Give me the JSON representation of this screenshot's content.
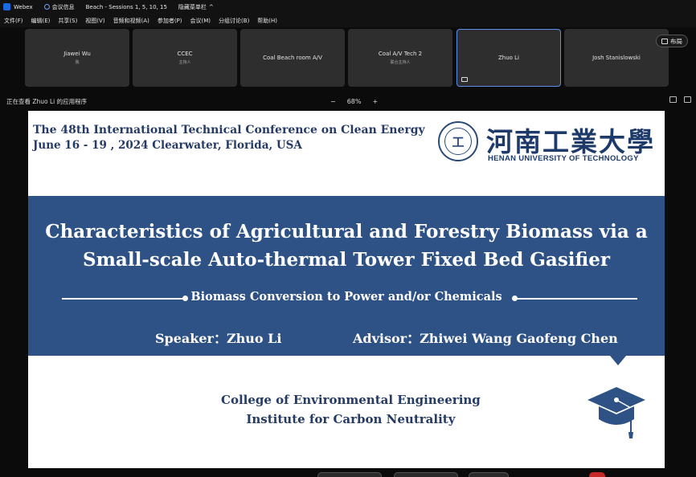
{
  "titlebar": {
    "app": "Webex",
    "meeting_info": "会议信息",
    "session": "Beach - Sessions 1, 5, 10, 15",
    "hide_menu": "隐藏菜单栏"
  },
  "menubar": [
    "文件(F)",
    "编辑(E)",
    "共享(S)",
    "视图(V)",
    "音频和视频(A)",
    "参加者(P)",
    "会议(M)",
    "分组讨论(B)",
    "帮助(H)"
  ],
  "participants": [
    {
      "name": "Jiawei Wu",
      "role": "我"
    },
    {
      "name": "CCEC",
      "role": "主持人"
    },
    {
      "name": "Coal Beach room A/V",
      "role": ""
    },
    {
      "name": "Coal A/V Tech 2",
      "role": "联合主持人"
    },
    {
      "name": "Zhuo Li",
      "role": ""
    },
    {
      "name": "Josh Stanislowski",
      "role": ""
    }
  ],
  "layout_button": "布局",
  "share_status": "正在查看 Zhuo Li 的应用程序",
  "zoom": {
    "minus": "−",
    "level": "68%",
    "plus": "+"
  },
  "slide": {
    "conference_line1": "The 48th International Technical Conference on Clean Energy",
    "conference_line2": "June 16 - 19 , 2024 Clearwater, Florida, USA",
    "university_cn": "河南工業大學",
    "university_en": "HENAN UNIVERSITY OF TECHNOLOGY",
    "seal_char": "工",
    "title_line1": "Characteristics of Agricultural and Forestry Biomass via a",
    "title_line2": "Small-scale Auto-thermal Tower Fixed Bed Gasifier",
    "subtitle": "Biomass Conversion to Power and/or Chemicals",
    "speaker": "Speaker：Zhuo Li",
    "advisor": "Advisor：Zhiwei Wang  Gaofeng Chen",
    "college_line1": "College of Environmental Engineering",
    "college_line2": "Institute for Carbon Neutrality"
  },
  "colors": {
    "banner": "#2f5286",
    "text_navy": "#253b66",
    "active_border": "#5b8ff2"
  }
}
